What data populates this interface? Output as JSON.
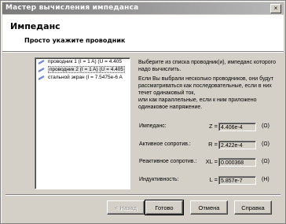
{
  "window": {
    "title": "Мастер вычисления импеданса",
    "close_glyph": "×"
  },
  "header": {
    "title": "Импеданс",
    "subtitle": "Просто укажите проводник"
  },
  "list": {
    "items": [
      {
        "label": "проводник 1 (I = 1 A) (U = 4.405",
        "icon": "conductor-icon",
        "selected": false
      },
      {
        "label": "проводник 2 (I = 1 A) (U = 4.405",
        "icon": "conductor-icon",
        "selected": true
      },
      {
        "label": "стальной экран (I = 7.5475e-6 A",
        "icon": "conductor-icon",
        "selected": false
      }
    ]
  },
  "description": {
    "p1": "Выберите из списка проводник(и), импеданс которого надо вычислить.",
    "p2": "Если Вы выбрали несколько проводников, они будут рассматриваться как последовательные, если в них течет одинаковый ток,",
    "p3": "или как параллельные, если к ним приложено одинаковое напряжение."
  },
  "results": {
    "impedance": {
      "label": "Импеданс:",
      "symbol": "Z =",
      "value": "4.406e-4",
      "unit": "(Ω)"
    },
    "resistance": {
      "label": "Активное сопротив.:",
      "symbol": "R =",
      "value": "2.422e-4",
      "unit": "(Ω)"
    },
    "reactance": {
      "label": "Реактивное сопротив.:",
      "symbol": "XL =",
      "value": "0.000368",
      "unit": "(Ω)"
    },
    "inductance": {
      "label": "Индуктивность:",
      "symbol": "L =",
      "value": "5.857e-7",
      "unit": "(H)"
    }
  },
  "buttons": {
    "back": "< Назад",
    "finish": "Готово",
    "cancel": "Отмена",
    "help": "Справка"
  },
  "colors": {
    "face": "#d4d0c8",
    "titlebar": "#7a7a7a",
    "icon_blue": "#3a5fcd"
  }
}
